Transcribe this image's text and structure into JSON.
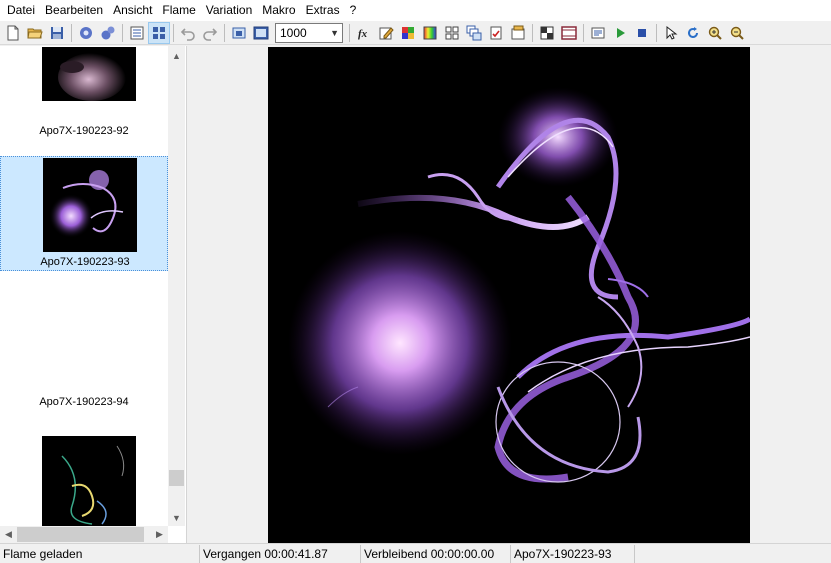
{
  "menu": [
    "Datei",
    "Bearbeiten",
    "Ansicht",
    "Flame",
    "Variation",
    "Makro",
    "Extras",
    "?"
  ],
  "toolbar": {
    "zoom_value": "1000",
    "icons": [
      "new-file-icon",
      "open-folder-icon",
      "save-icon",
      "render-gear-icon",
      "batch-gear-icon",
      "list-view-icon",
      "icon-view-icon",
      "undo-icon",
      "redo-icon",
      "small-window-icon",
      "fullscreen-icon",
      "fx-editor-icon",
      "edit-icon",
      "color-grid-icon",
      "gradient-icon",
      "mutate-icon",
      "layers-icon",
      "adjust-icon",
      "post-process-icon",
      "transparency-icon",
      "film-icon",
      "script-icon",
      "play-icon",
      "stop-icon",
      "pointer-icon",
      "rotate-icon",
      "zoom-in-icon",
      "zoom-out-icon"
    ]
  },
  "flames": [
    {
      "label": "Apo7X-190223-92",
      "selected": false
    },
    {
      "label": "Apo7X-190223-93",
      "selected": true
    },
    {
      "label": "Apo7X-190223-94",
      "selected": false
    },
    {
      "label": "",
      "selected": false
    }
  ],
  "status": {
    "message": "Flame geladen",
    "elapsed": "Vergangen 00:00:41.87",
    "remaining": "Verbleibend 00:00:00.00",
    "flame_name": "Apo7X-190223-93"
  }
}
